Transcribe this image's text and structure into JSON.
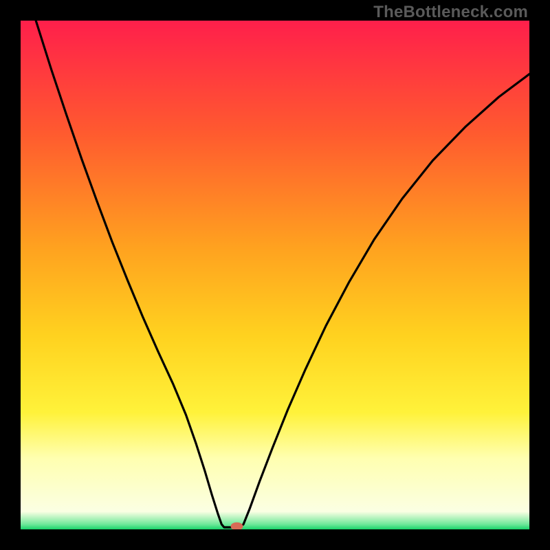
{
  "watermark": "TheBottleneck.com",
  "chart_data": {
    "type": "line",
    "title": "",
    "xlabel": "",
    "ylabel": "",
    "xlim": [
      0,
      1
    ],
    "ylim": [
      0,
      1
    ],
    "background": {
      "type": "vertical-gradient",
      "stops": [
        {
          "offset": 0.0,
          "color": "#ff1f4b"
        },
        {
          "offset": 0.22,
          "color": "#ff5a2f"
        },
        {
          "offset": 0.45,
          "color": "#ffa31f"
        },
        {
          "offset": 0.62,
          "color": "#ffd21f"
        },
        {
          "offset": 0.77,
          "color": "#fff23a"
        },
        {
          "offset": 0.86,
          "color": "#ffffb0"
        },
        {
          "offset": 0.965,
          "color": "#fbffe3"
        },
        {
          "offset": 0.99,
          "color": "#6fe89a"
        },
        {
          "offset": 1.0,
          "color": "#18d36a"
        }
      ]
    },
    "series": [
      {
        "name": "bottleneck-curve",
        "stroke": "#000000",
        "points": [
          {
            "x": 0.03,
            "y": 1.0
          },
          {
            "x": 0.06,
            "y": 0.905
          },
          {
            "x": 0.09,
            "y": 0.815
          },
          {
            "x": 0.12,
            "y": 0.728
          },
          {
            "x": 0.15,
            "y": 0.645
          },
          {
            "x": 0.18,
            "y": 0.565
          },
          {
            "x": 0.21,
            "y": 0.49
          },
          {
            "x": 0.24,
            "y": 0.418
          },
          {
            "x": 0.27,
            "y": 0.35
          },
          {
            "x": 0.3,
            "y": 0.285
          },
          {
            "x": 0.325,
            "y": 0.225
          },
          {
            "x": 0.345,
            "y": 0.168
          },
          {
            "x": 0.362,
            "y": 0.115
          },
          {
            "x": 0.376,
            "y": 0.068
          },
          {
            "x": 0.388,
            "y": 0.03
          },
          {
            "x": 0.395,
            "y": 0.01
          },
          {
            "x": 0.4,
            "y": 0.004
          },
          {
            "x": 0.408,
            "y": 0.004
          },
          {
            "x": 0.42,
            "y": 0.004
          },
          {
            "x": 0.43,
            "y": 0.004
          },
          {
            "x": 0.438,
            "y": 0.01
          },
          {
            "x": 0.45,
            "y": 0.04
          },
          {
            "x": 0.47,
            "y": 0.095
          },
          {
            "x": 0.495,
            "y": 0.16
          },
          {
            "x": 0.525,
            "y": 0.235
          },
          {
            "x": 0.56,
            "y": 0.315
          },
          {
            "x": 0.6,
            "y": 0.4
          },
          {
            "x": 0.645,
            "y": 0.485
          },
          {
            "x": 0.695,
            "y": 0.57
          },
          {
            "x": 0.75,
            "y": 0.65
          },
          {
            "x": 0.81,
            "y": 0.725
          },
          {
            "x": 0.875,
            "y": 0.792
          },
          {
            "x": 0.94,
            "y": 0.85
          },
          {
            "x": 1.0,
            "y": 0.895
          }
        ]
      }
    ],
    "marker": {
      "x": 0.425,
      "y": 0.006,
      "rx": 0.012,
      "ry": 0.008,
      "fill": "#d86b56"
    }
  }
}
